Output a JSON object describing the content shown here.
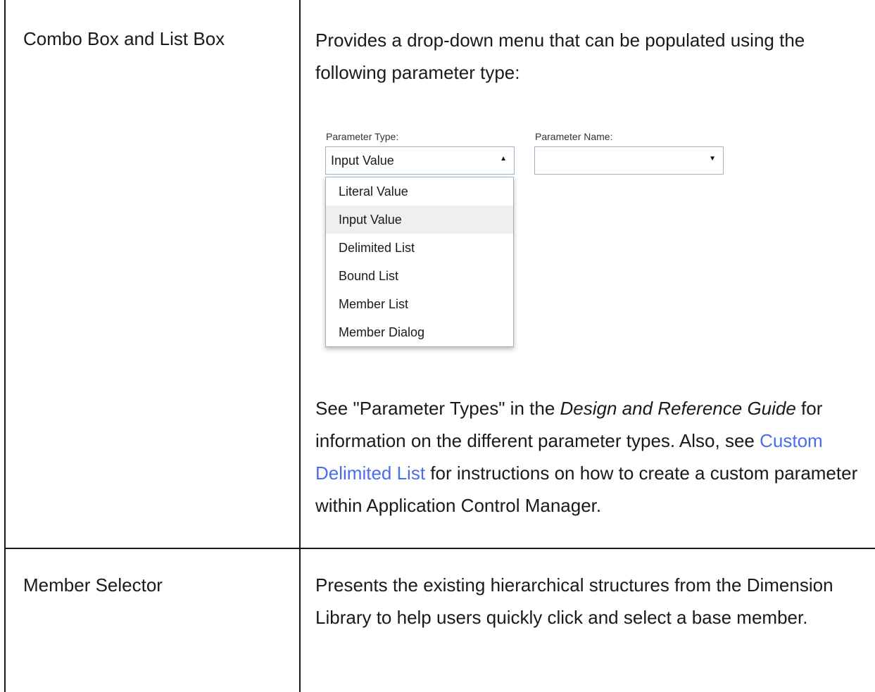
{
  "rows": [
    {
      "name": "Combo Box and List Box",
      "intro": "Provides a drop-down menu that can be populated using the following parameter type:",
      "widget": {
        "type_label": "Parameter Type:",
        "type_value": "Input Value",
        "name_label": "Parameter Name:",
        "name_value": "",
        "options": [
          "Literal Value",
          "Input Value",
          "Delimited List",
          "Bound List",
          "Member List",
          "Member Dialog"
        ],
        "selected_option": "Input Value"
      },
      "see_prefix": "See \"Parameter Types\" in the ",
      "see_guide": "Design and Reference Guide",
      "see_middle": " for information on the different parameter types. Also, see ",
      "link_text": "Custom Delimited List",
      "see_suffix": " for instructions on how to create a custom parameter within Application Control Manager."
    },
    {
      "name": "Member Selector",
      "description": "Presents the existing hierarchical structures from the Dimension Library to help users quickly click and select a base member."
    }
  ],
  "colors": {
    "link": "#4a6cf0",
    "border": "#1a1a1a",
    "selected_bg": "#efefef"
  }
}
